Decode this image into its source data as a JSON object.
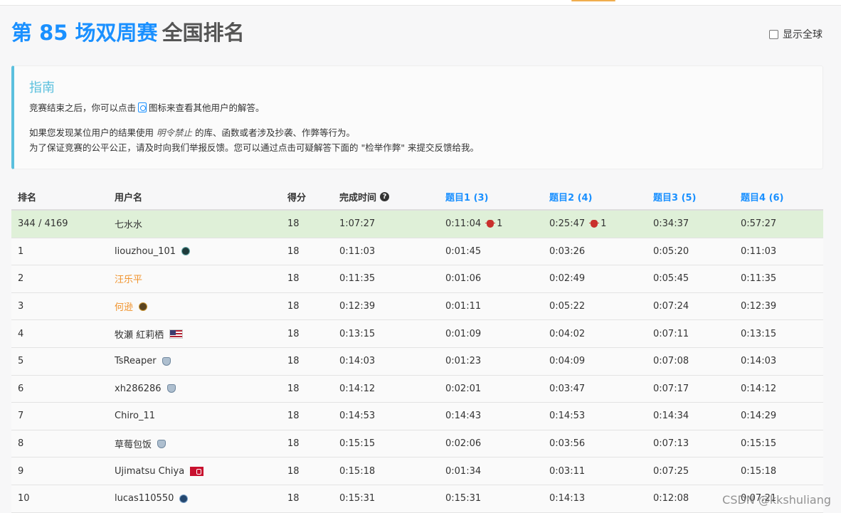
{
  "header": {
    "contest_name": "第 85 场双周赛",
    "page_label": "全国排名",
    "show_global_label": "显示全球"
  },
  "guide": {
    "title": "指南",
    "line1_before": "竞赛结束之后，你可以点击",
    "line1_after": "图标来查看其他用户的解答。",
    "line2_before": "如果您发现某位用户的结果使用",
    "line2_em": "明令禁止",
    "line2_after": "的库、函数或者涉及抄袭、作弊等行为。",
    "line3": "为了保证竞赛的公平公正，请及时向我们举报反馈。您可以通过点击可疑解答下面的 \"检举作弊\" 来提交反馈给我。"
  },
  "table": {
    "headers": {
      "rank": "排名",
      "user": "用户名",
      "score": "得分",
      "time": "完成时间",
      "q1": "题目1 (3)",
      "q2": "题目2 (4)",
      "q3": "题目3 (5)",
      "q4": "题目4 (6)"
    },
    "rows": [
      {
        "rank": "344 / 4169",
        "user": "七水水",
        "score": "18",
        "time": "1:07:27",
        "q1": "0:11:04",
        "q1_bugs": "1",
        "q2": "0:25:47",
        "q2_bugs": "1",
        "q3": "0:34:37",
        "q4": "0:57:27"
      },
      {
        "rank": "1",
        "user": "liouzhou_101",
        "score": "18",
        "time": "0:11:03",
        "q1": "0:01:45",
        "q2": "0:03:26",
        "q3": "0:05:20",
        "q4": "0:11:03"
      },
      {
        "rank": "2",
        "user": "汪乐平",
        "score": "18",
        "time": "0:11:35",
        "q1": "0:01:06",
        "q2": "0:02:49",
        "q3": "0:05:45",
        "q4": "0:11:35"
      },
      {
        "rank": "3",
        "user": "何逊",
        "score": "18",
        "time": "0:12:39",
        "q1": "0:01:11",
        "q2": "0:05:22",
        "q3": "0:07:24",
        "q4": "0:12:39"
      },
      {
        "rank": "4",
        "user": "牧瀬 紅莉栖",
        "score": "18",
        "time": "0:13:15",
        "q1": "0:01:09",
        "q2": "0:04:02",
        "q3": "0:07:11",
        "q4": "0:13:15"
      },
      {
        "rank": "5",
        "user": "TsReaper",
        "score": "18",
        "time": "0:14:03",
        "q1": "0:01:23",
        "q2": "0:04:09",
        "q3": "0:07:08",
        "q4": "0:14:03"
      },
      {
        "rank": "6",
        "user": "xh286286",
        "score": "18",
        "time": "0:14:12",
        "q1": "0:02:01",
        "q2": "0:03:47",
        "q3": "0:07:17",
        "q4": "0:14:12"
      },
      {
        "rank": "7",
        "user": "Chiro_11",
        "score": "18",
        "time": "0:14:53",
        "q1": "0:14:43",
        "q2": "0:14:53",
        "q3": "0:14:34",
        "q4": "0:14:29"
      },
      {
        "rank": "8",
        "user": "草莓包饭",
        "score": "18",
        "time": "0:15:15",
        "q1": "0:02:06",
        "q2": "0:03:56",
        "q3": "0:07:13",
        "q4": "0:15:15"
      },
      {
        "rank": "9",
        "user": "Ujimatsu Chiya",
        "score": "18",
        "time": "0:15:18",
        "q1": "0:01:34",
        "q2": "0:03:11",
        "q3": "0:07:25",
        "q4": "0:15:18"
      },
      {
        "rank": "10",
        "user": "lucas110550",
        "score": "18",
        "time": "0:15:31",
        "q1": "0:15:31",
        "q2": "0:14:13",
        "q3": "0:12:08",
        "q4": "0:07:21"
      }
    ]
  },
  "icons": {
    "solution_icon": "doc-icon",
    "help_icon": "question-circle-icon",
    "bug_icon": "bug-icon"
  },
  "colors": {
    "accent": "#1a90ff",
    "guide_border": "#5bc0de",
    "my_row": "#dff0d8",
    "orange_name": "#f0922b",
    "bug": "#c9302c"
  },
  "watermark": "CSDN @kkshuliang"
}
